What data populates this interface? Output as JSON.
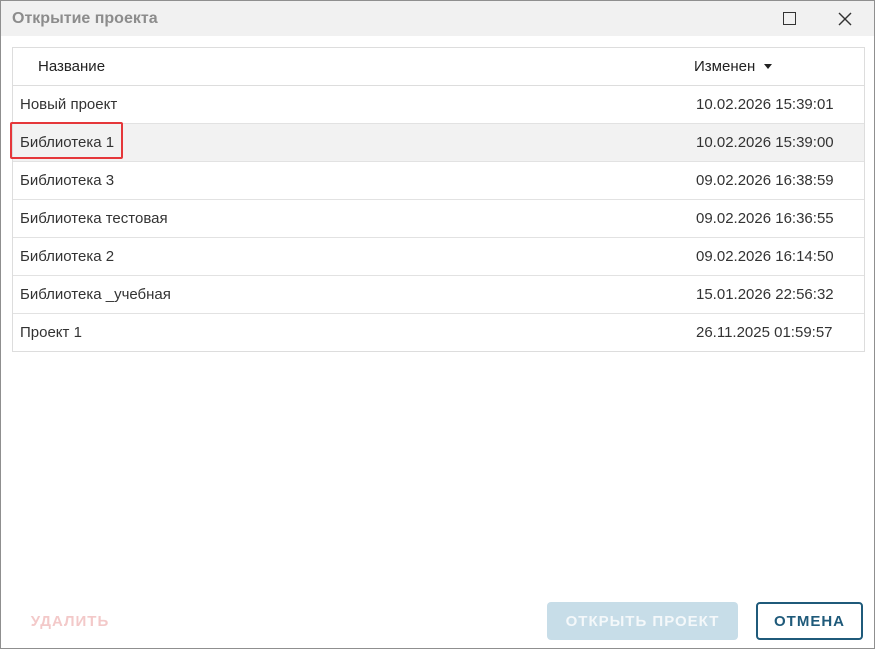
{
  "window": {
    "title": "Открытие проекта"
  },
  "table": {
    "columns": {
      "name": "Название",
      "modified": "Изменен"
    },
    "rows": [
      {
        "name": "Новый проект",
        "modified": "10.02.2026 15:39:01"
      },
      {
        "name": "Библиотека 1",
        "modified": "10.02.2026 15:39:00"
      },
      {
        "name": "Библиотека 3",
        "modified": "09.02.2026 16:38:59"
      },
      {
        "name": "Библиотека тестовая",
        "modified": "09.02.2026 16:36:55"
      },
      {
        "name": "Библиотека 2",
        "modified": "09.02.2026 16:14:50"
      },
      {
        "name": "Библиотека _учебная",
        "modified": "15.01.2026 22:56:32"
      },
      {
        "name": "Проект 1",
        "modified": "26.11.2025 01:59:57"
      }
    ],
    "selected_index": 1
  },
  "buttons": {
    "delete": "УДАЛИТЬ",
    "open": "ОТКРЫТЬ ПРОЕКТ",
    "cancel": "ОТМЕНА"
  },
  "colors": {
    "accent": "#1f5a7a",
    "highlight": "#e5373a",
    "disabled_primary": "#c7dde8"
  },
  "icons": {
    "maximize": "maximize-icon",
    "close": "close-icon",
    "sort": "sort-desc-icon"
  }
}
